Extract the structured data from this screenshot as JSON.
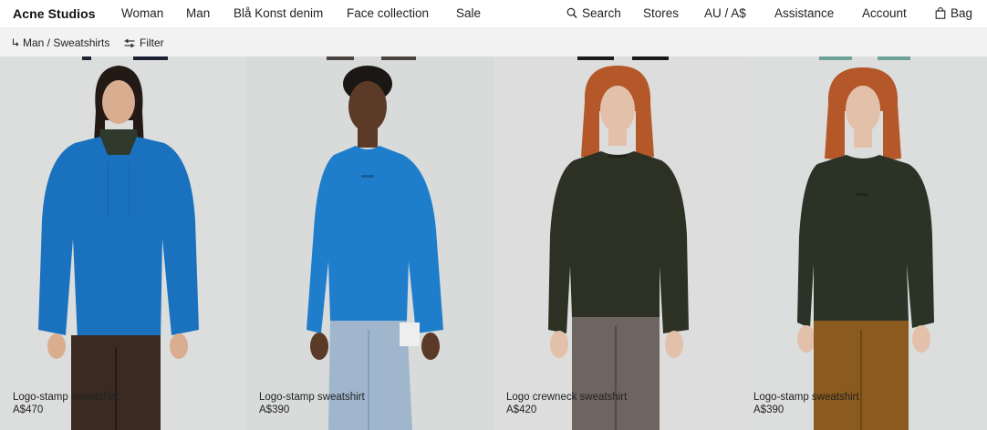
{
  "header": {
    "brand": "Acne Studios",
    "nav": [
      "Woman",
      "Man",
      "Blå Konst denim",
      "Face collection",
      "Sale"
    ],
    "search": "Search",
    "stores": "Stores",
    "region": "AU / A$",
    "assistance": "Assistance",
    "account": "Account",
    "bag": "Bag"
  },
  "subbar": {
    "breadcrumb": "Man / Sweatshirts",
    "filter": "Filter"
  },
  "products": [
    {
      "name": "Logo-stamp sweatshirt",
      "price": "A$470",
      "color": "#1a72bf"
    },
    {
      "name": "Logo-stamp sweatshirt",
      "price": "A$390",
      "color": "#1f7ecb"
    },
    {
      "name": "Logo crewneck sweatshirt",
      "price": "A$420",
      "color": "#2c3124"
    },
    {
      "name": "Logo-stamp sweatshirt",
      "price": "A$390",
      "color": "#2b3327"
    }
  ],
  "icons": {
    "search": "search-icon",
    "bag": "bag-icon",
    "breadcrumb": "return-arrow-icon",
    "filter": "sliders-icon"
  }
}
